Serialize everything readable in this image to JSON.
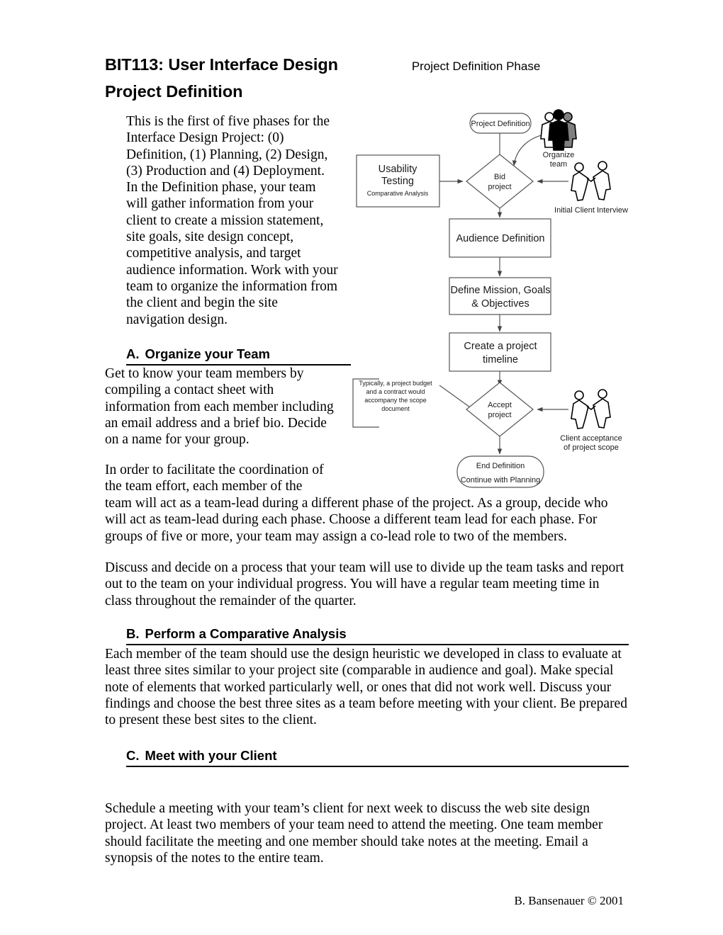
{
  "header": {
    "title": "BIT113: User Interface Design",
    "phase": "Project Definition Phase",
    "subtitle": "Project Definition"
  },
  "intro": "This is the first of five phases for the Interface Design Project: (0) Definition, (1) Planning, (2) Design, (3) Production and (4) Deployment. In the Definition phase, your team will gather information from your client to create a mission statement, site goals, site design concept, competitive analysis, and target audience information. Work with your team to organize the information from the client and begin the site navigation design.",
  "sections": {
    "a": {
      "letter": "A.",
      "title": "Organize your Team",
      "p1": "Get to know your team members by compiling a contact sheet with information from each member including an email address and a brief bio. Decide on a name for your group.",
      "p2_narrow": "In order to facilitate the coordination of the team effort, each member of the",
      "p2_wide": "team will act as a team-lead during a different phase of the project. As a group, decide who will act as team-lead during each phase. Choose a different team lead for each phase. For groups of five or more, your team may assign a co-lead role to two of the members.",
      "p3": "Discuss and decide on a process that your team will use to divide up the team tasks and report out to the team on your individual progress. You will have a regular team meeting time in class throughout the remainder of the quarter."
    },
    "b": {
      "letter": "B.",
      "title": "Perform a Comparative Analysis",
      "p1": "Each member of the team should use the design heuristic we developed in class to evaluate at least three sites similar to your project site (comparable in audience and goal). Make special note of elements that worked particularly well, or ones that did not work well. Discuss your findings and choose the best three sites as a team before meeting with your client. Be prepared to present these best sites to the client."
    },
    "c": {
      "letter": "C.",
      "title": "Meet with your Client",
      "p1": "Schedule a meeting with your team’s client for next week to discuss the web site design project. At least two members of your team need to attend the meeting. One team member should facilitate the meeting and one member should take notes at the meeting. Email a synopsis of the notes to the entire team."
    }
  },
  "footer": {
    "credit": "B. Bansenauer © 2001"
  },
  "flowchart": {
    "start": "Project Definition",
    "decision_bid_line1": "Bid",
    "decision_bid_line2": "project",
    "usability_line1": "Usability",
    "usability_line2": "Testing",
    "usability_sub": "Comparative Analysis",
    "organize_team_line1": "Organize",
    "organize_team_line2": "team",
    "initial_interview": "Initial Client Interview",
    "audience_definition": "Audience Definition",
    "define_mission_line1": "Define Mission, Goals",
    "define_mission_line2": "& Objectives",
    "timeline_line1": "Create a project",
    "timeline_line2": "timeline",
    "decision_accept_line1": "Accept",
    "decision_accept_line2": "project",
    "note_line1": "Typically, a project budget",
    "note_line2": "and a contract would",
    "note_line3": "accompany the scope",
    "note_line4": "document",
    "client_acceptance_line1": "Client acceptance",
    "client_acceptance_line2": "of project scope",
    "end_line1": "End Definition",
    "end_line2": "Continue with Planning"
  },
  "colors": {
    "stroke": "#555555",
    "text": "#1a1a1a",
    "page_bg": "#ffffff",
    "figure_dark": "#000000",
    "figure_gray": "#808080"
  }
}
